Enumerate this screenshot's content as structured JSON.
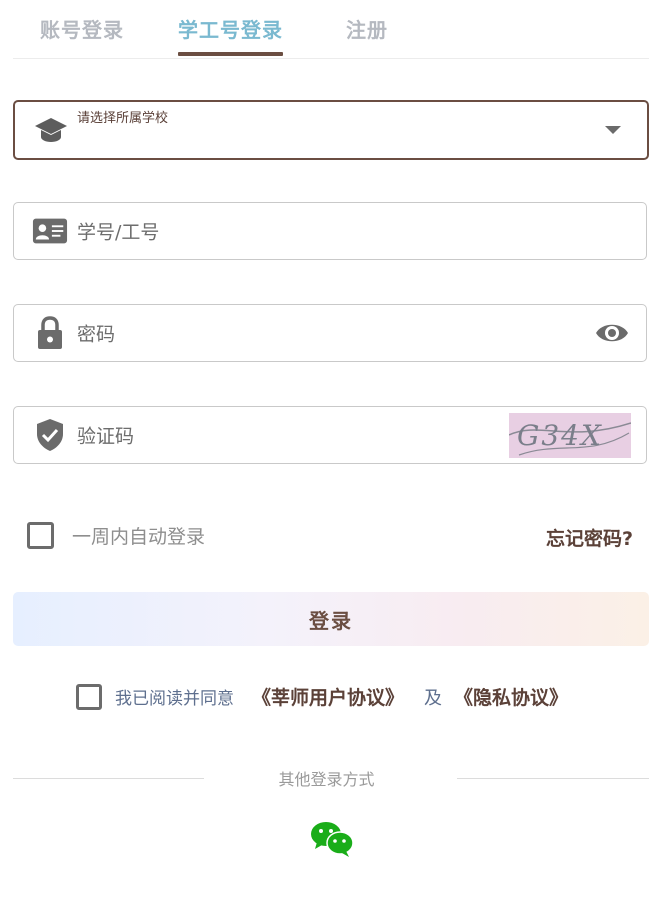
{
  "tabs": [
    {
      "label": "账号登录",
      "active": false
    },
    {
      "label": "学工号登录",
      "active": true
    },
    {
      "label": "注册",
      "active": false
    }
  ],
  "school_select": {
    "label": "请选择所属学校",
    "icon": "graduation-cap-icon"
  },
  "student_id": {
    "placeholder": "学号/工号",
    "icon": "id-card-icon"
  },
  "password": {
    "placeholder": "密码",
    "icon": "lock-icon",
    "toggle_icon": "eye-icon"
  },
  "captcha": {
    "placeholder": "验证码",
    "icon": "shield-check-icon",
    "image_text": "G34X"
  },
  "remember": {
    "label": "一周内自动登录",
    "checked": false
  },
  "forgot": {
    "label": "忘记密码?"
  },
  "login_button": {
    "label": "登录"
  },
  "agreement": {
    "prefix": "我已阅读并同意",
    "user_agreement": "《莘师用户协议》",
    "and": "及",
    "privacy": "《隐私协议》",
    "checked": false
  },
  "other_login": {
    "label": "其他登录方式",
    "icon": "wechat-icon"
  },
  "colors": {
    "accent": "#6b4e42",
    "active_tab": "#7ab9d0",
    "wechat": "#1aad19"
  }
}
